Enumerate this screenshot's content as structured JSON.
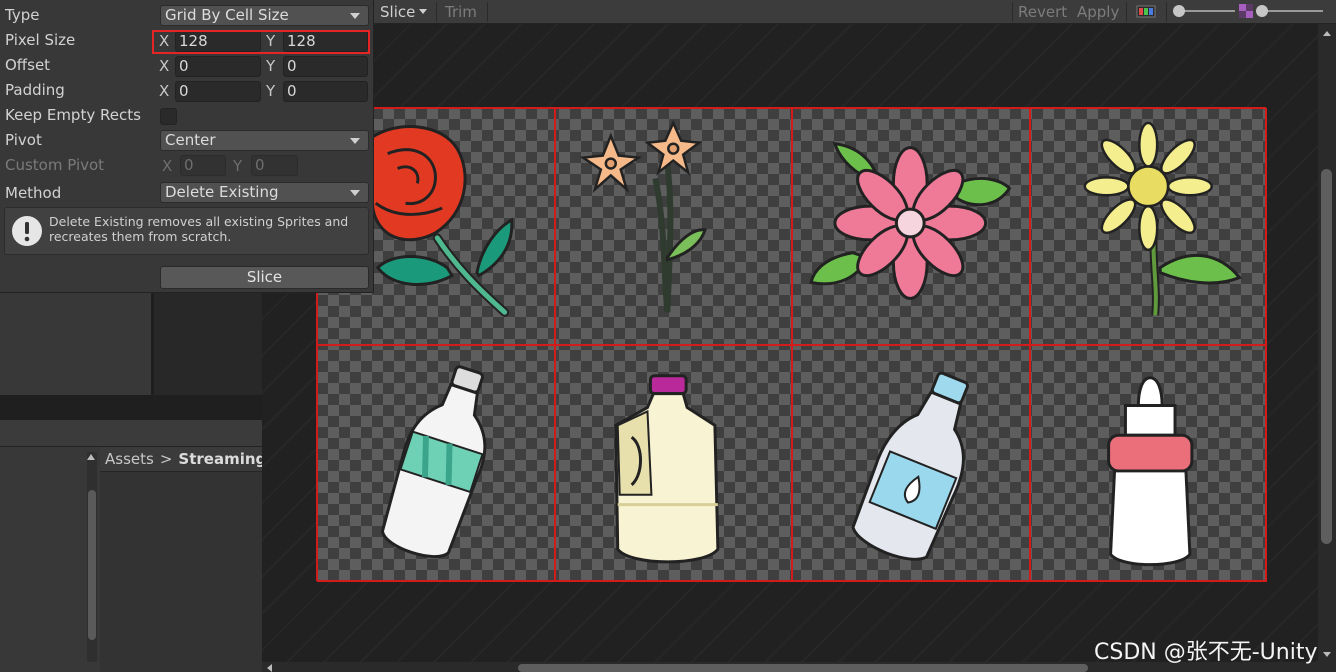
{
  "toolbar": {
    "slice_label": "Slice",
    "trim_label": "Trim",
    "revert_label": "Revert",
    "apply_label": "Apply"
  },
  "slice_panel": {
    "type": {
      "label": "Type",
      "value": "Grid By Cell Size"
    },
    "pixel_size": {
      "label": "Pixel Size",
      "x_axis": "X",
      "x": "128",
      "y_axis": "Y",
      "y": "128"
    },
    "offset": {
      "label": "Offset",
      "x_axis": "X",
      "x": "0",
      "y_axis": "Y",
      "y": "0"
    },
    "padding": {
      "label": "Padding",
      "x_axis": "X",
      "x": "0",
      "y_axis": "Y",
      "y": "0"
    },
    "keep_empty_rects": {
      "label": "Keep Empty Rects",
      "checked": false
    },
    "pivot": {
      "label": "Pivot",
      "value": "Center"
    },
    "custom_pivot": {
      "label": "Custom Pivot",
      "x_axis": "X",
      "x": "0",
      "y_axis": "Y",
      "y": "0"
    },
    "method": {
      "label": "Method",
      "value": "Delete Existing"
    },
    "help_text": "Delete Existing removes all existing Sprites and recreates them from scratch.",
    "slice_button": "Slice"
  },
  "breadcrumb": {
    "root": "Assets",
    "separator": ">",
    "current": "StreamingA"
  },
  "sprite_sheet": {
    "cells": [
      {
        "icon": "rose-icon"
      },
      {
        "icon": "lily-flower-icon"
      },
      {
        "icon": "pink-flower-icon"
      },
      {
        "icon": "daisy-icon"
      },
      {
        "icon": "water-bottle-icon"
      },
      {
        "icon": "milk-jug-icon"
      },
      {
        "icon": "plastic-bottle-icon"
      },
      {
        "icon": "baby-bottle-icon"
      }
    ]
  },
  "colors": {
    "slice_outline": "#d21c1c",
    "pixel_size_highlight": "#e52424",
    "panel_bg": "#383838"
  },
  "watermark": "CSDN @张不无-Unity"
}
